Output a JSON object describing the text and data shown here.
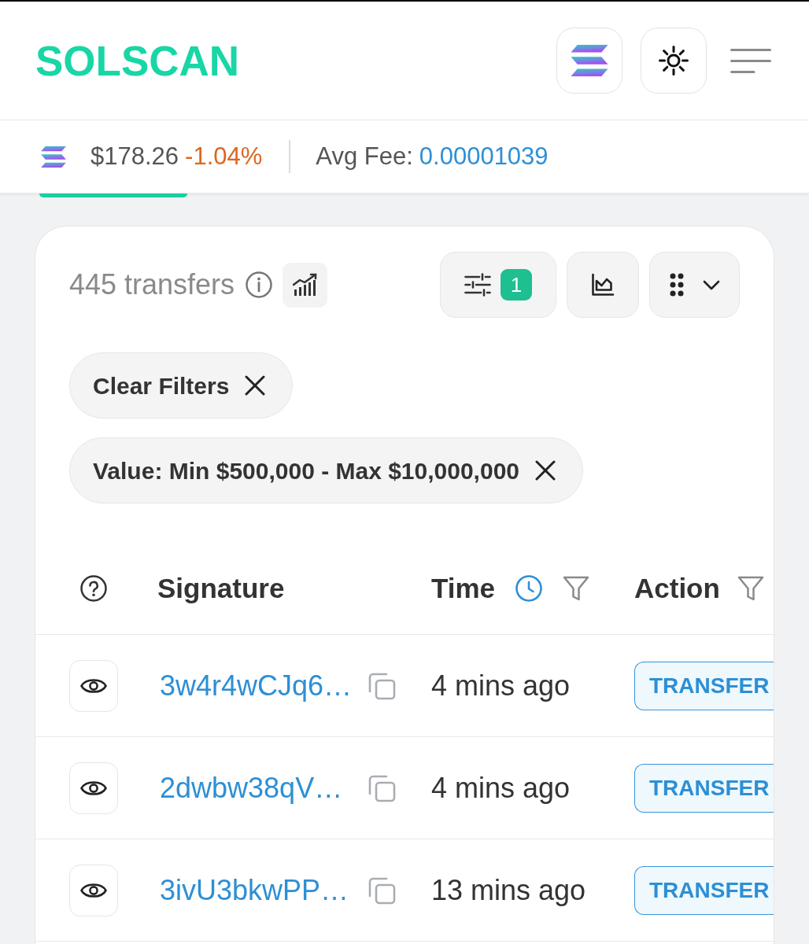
{
  "header": {
    "logo": "SOLSCAN"
  },
  "price_bar": {
    "price": "$178.26",
    "change": "-1.04%",
    "fee_label": "Avg Fee:",
    "fee_value": "0.00001039"
  },
  "transfers": {
    "count": "445 transfers",
    "filter_count": "1",
    "chips": [
      {
        "label": "Clear Filters"
      },
      {
        "label": "Value: Min $500,000 - Max $10,000,000"
      }
    ]
  },
  "table": {
    "columns": [
      {
        "kind": "signature",
        "label": "Signature",
        "filterable": false
      },
      {
        "kind": "time",
        "label": "Time",
        "filterable": true
      },
      {
        "kind": "action",
        "label": "Action",
        "filterable": true
      }
    ],
    "rows": [
      {
        "signature": "3w4r4wCJq6…",
        "time": "4 mins ago",
        "action": "TRANSFER"
      },
      {
        "signature": "2dwbw38qV…",
        "time": "4 mins ago",
        "action": "TRANSFER"
      },
      {
        "signature": "3ivU3bkwPP…",
        "time": "13 mins ago",
        "action": "TRANSFER"
      }
    ]
  }
}
